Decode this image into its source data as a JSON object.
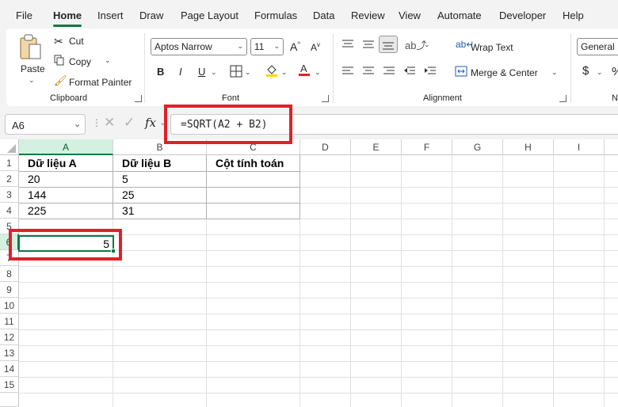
{
  "menu": {
    "items": [
      "File",
      "Home",
      "Insert",
      "Draw",
      "Page Layout",
      "Formulas",
      "Data",
      "Review",
      "View",
      "Automate",
      "Developer",
      "Help"
    ],
    "active": "Home"
  },
  "ribbon": {
    "clipboard": {
      "paste_label": "Paste",
      "cut_label": "Cut",
      "copy_label": "Copy",
      "format_painter_label": "Format Painter",
      "group_label": "Clipboard"
    },
    "font": {
      "font_name": "Aptos Narrow",
      "font_size": "11",
      "bold": "B",
      "italic": "I",
      "underline": "U",
      "group_label": "Font",
      "fill_color": "#ffd700",
      "font_color": "#e0202a"
    },
    "alignment": {
      "wrap_text_label": "Wrap Text",
      "merge_center_label": "Merge & Center",
      "group_label": "Alignment"
    },
    "number": {
      "format": "General",
      "currency_symbol": "$",
      "percent_symbol": "%",
      "group_label_partial": "N"
    }
  },
  "formula_bar": {
    "name_box": "A6",
    "fx_label": "fx",
    "formula": "=SQRT(A2 + B2)"
  },
  "sheet": {
    "columns": [
      "A",
      "B",
      "C",
      "D",
      "E",
      "F",
      "G",
      "H",
      "I"
    ],
    "rows": [
      "1",
      "2",
      "3",
      "4",
      "5",
      "6",
      "7",
      "8",
      "9",
      "10",
      "11",
      "12",
      "13",
      "14",
      "15"
    ],
    "selected_cell": "A6",
    "cells": {
      "A1": "Dữ liệu A",
      "B1": "Dữ liệu B",
      "C1": "Cột tính toán",
      "A2": "20",
      "B2": "5",
      "A3": "144",
      "B3": "25",
      "A4": "225",
      "B4": "31",
      "A6": "5"
    }
  },
  "colors": {
    "accent": "#117744",
    "highlight": "#e0202a"
  }
}
